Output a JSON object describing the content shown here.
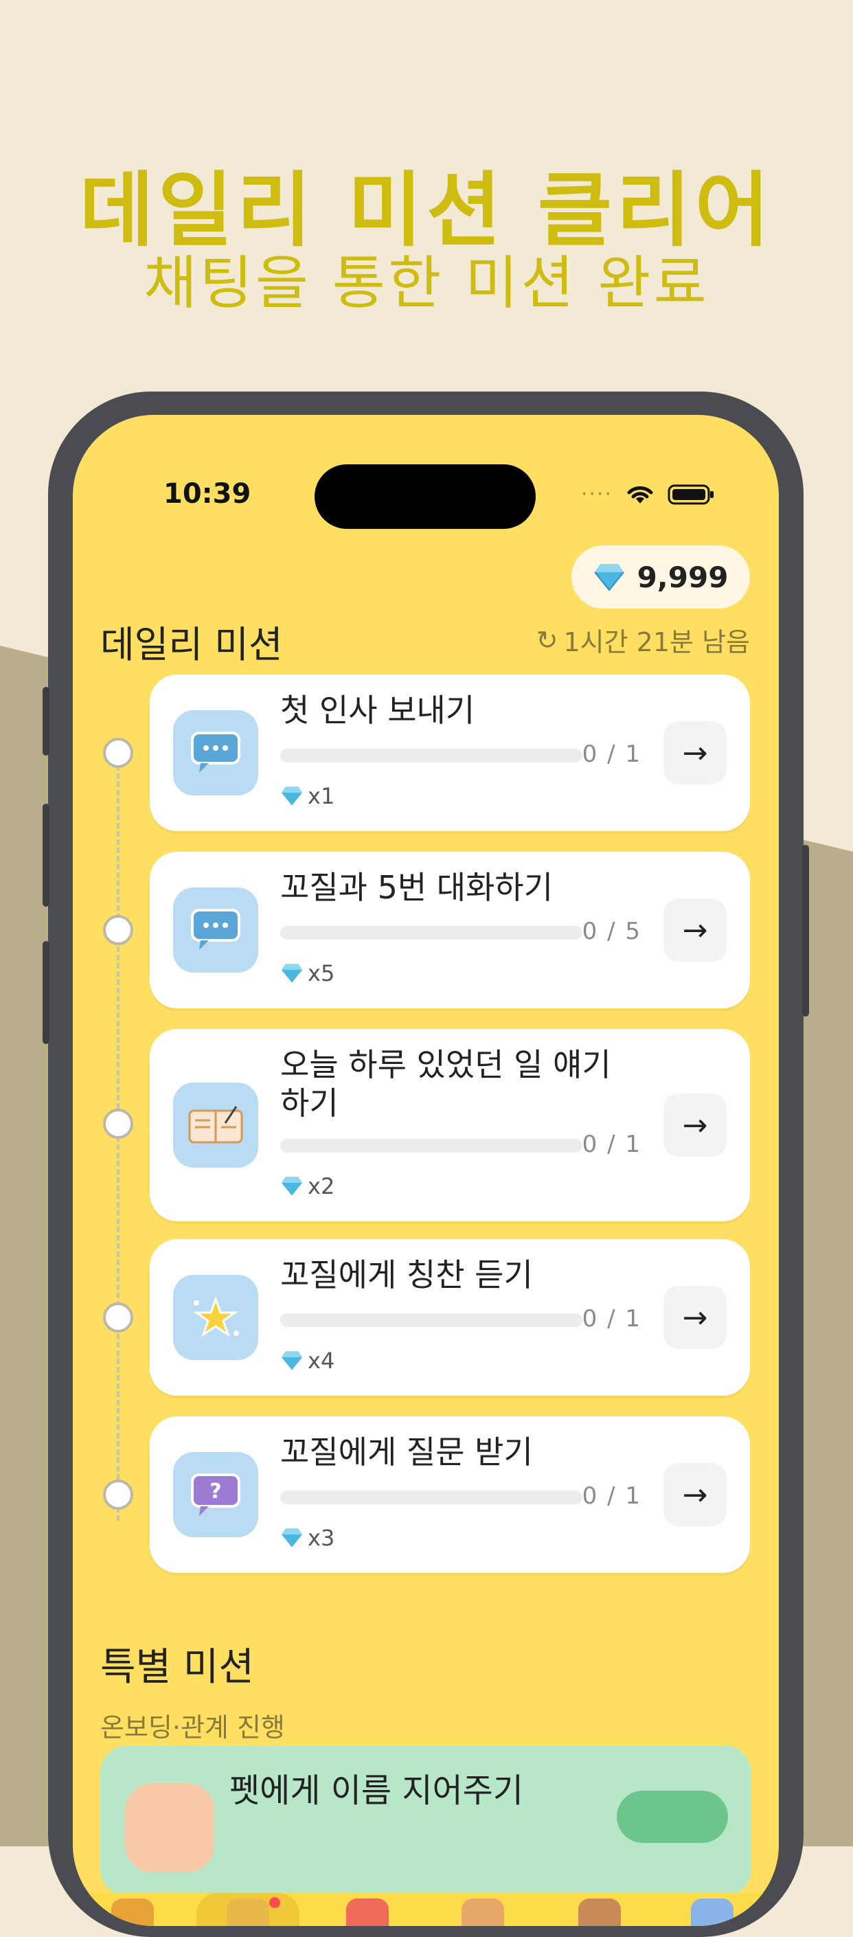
{
  "promo": {
    "headline": "데일리 미션 클리어",
    "subheadline": "채팅을 통한 미션 완료"
  },
  "status_bar": {
    "time": "10:39",
    "signal": "····"
  },
  "wallet": {
    "gem_count": "9,999"
  },
  "daily": {
    "title": "데일리 미션",
    "timer": "1시간 21분 남음",
    "missions": [
      {
        "title": "첫 인사 보내기",
        "progress": "0 / 1",
        "progress_value": 0,
        "reward": "x1",
        "icon": "chat-bubble-icon"
      },
      {
        "title": "꼬질과 5번 대화하기",
        "progress": "0 / 5",
        "progress_value": 0,
        "reward": "x5",
        "icon": "chat-bubble-icon"
      },
      {
        "title": "오늘 하루 있었던 일 얘기하기",
        "progress": "0 / 1",
        "progress_value": 0,
        "reward": "x2",
        "icon": "diary-book-icon"
      },
      {
        "title": "꼬질에게 칭찬 듣기",
        "progress": "0 / 1",
        "progress_value": 0,
        "reward": "x4",
        "icon": "sparkle-star-icon"
      },
      {
        "title": "꼬질에게 질문 받기",
        "progress": "0 / 1",
        "progress_value": 0,
        "reward": "x3",
        "icon": "question-bubble-icon"
      }
    ]
  },
  "special": {
    "title": "특별 미션",
    "subtitle": "온보딩·관계 진행",
    "mission_title": "펫에게 이름 지어주기"
  },
  "colors": {
    "screen_bg": "#fedf62",
    "headline": "#cfbc10",
    "gem": "#4bb7e0",
    "special_card": "#b7e6c9"
  }
}
